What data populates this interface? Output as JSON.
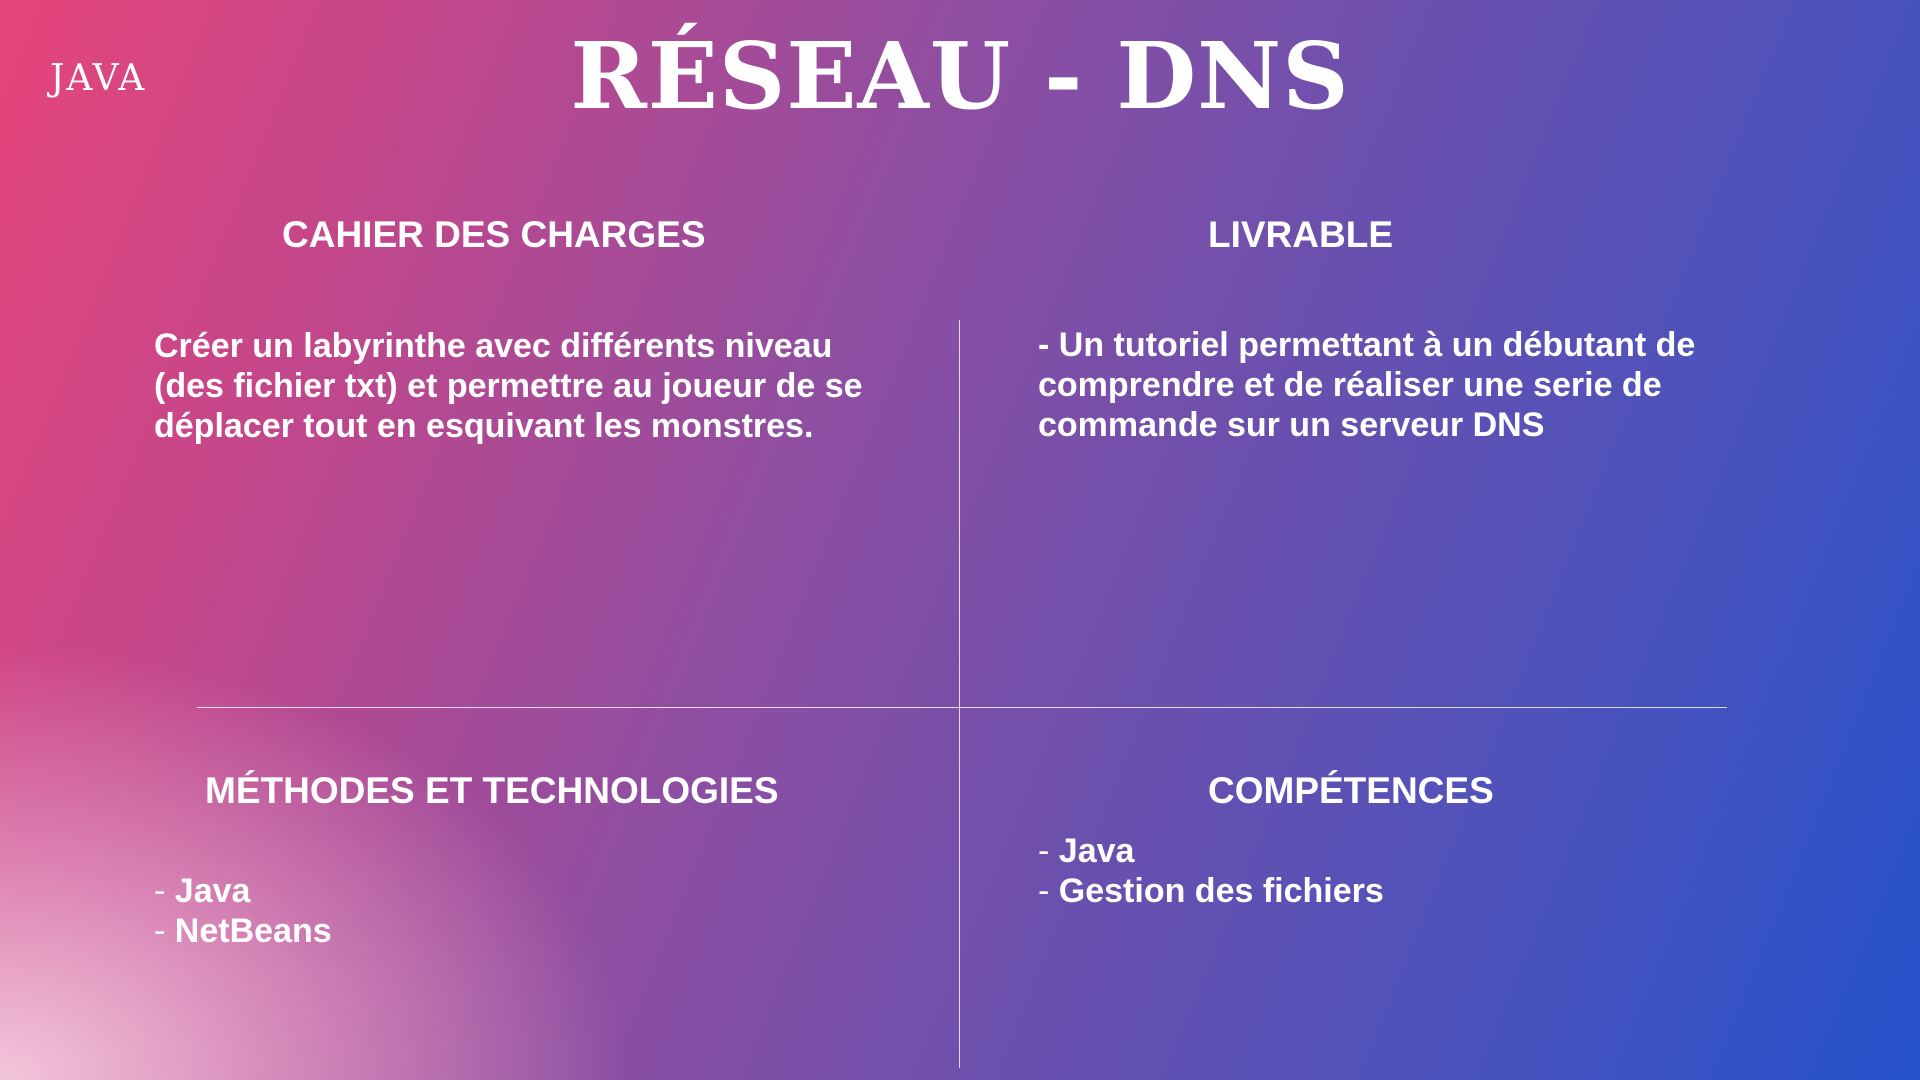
{
  "header": {
    "tag": "JAVA",
    "title": "RÉSEAU - DNS"
  },
  "sections": {
    "cahier": {
      "heading": "CAHIER DES CHARGES",
      "lines": [
        "Créer un labyrinthe avec différents niveau",
        "(des fichier txt) et permettre au joueur de se",
        "déplacer tout en esquivant les monstres."
      ]
    },
    "livrable": {
      "heading": "LIVRABLE",
      "lines": [
        "- Un tutoriel permettant à un débutant de",
        "comprendre et de réaliser une serie de",
        "commande sur un serveur DNS"
      ]
    },
    "methodes": {
      "heading": "MÉTHODES ET TECHNOLOGIES",
      "items": [
        "Java",
        "NetBeans"
      ]
    },
    "competences": {
      "heading": "COMPÉTENCES",
      "items": [
        "Java",
        "Gestion des fichiers"
      ]
    }
  },
  "list_marker": "- "
}
